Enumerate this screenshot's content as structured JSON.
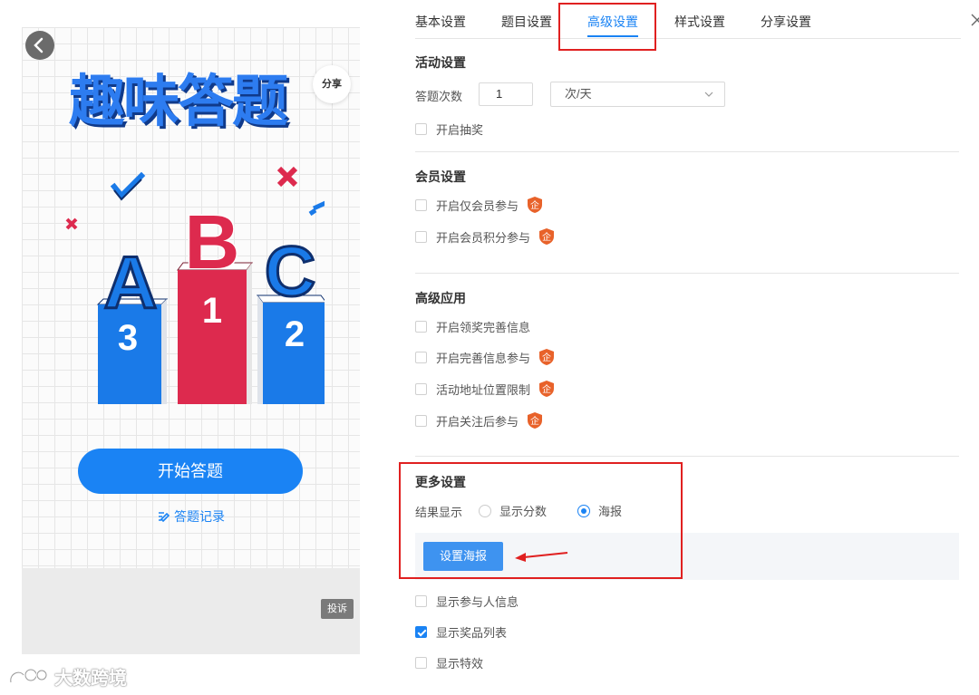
{
  "preview": {
    "back_icon": "chevron-left-icon",
    "share_label": "分享",
    "game_title": "趣味答题",
    "podium": {
      "letters": [
        "A",
        "B",
        "C"
      ],
      "ranks": [
        "3",
        "1",
        "2"
      ],
      "colors": {
        "blue": "#1a7ae8",
        "red": "#dd2a4e",
        "dark": "#0e2f6e"
      }
    },
    "start_button": "开始答题",
    "record_link": "答题记录",
    "complain_button": "投诉"
  },
  "watermark": "大数跨境",
  "settings": {
    "tabs": [
      {
        "label": "基本设置",
        "active": false
      },
      {
        "label": "题目设置",
        "active": false
      },
      {
        "label": "高级设置",
        "active": true
      },
      {
        "label": "样式设置",
        "active": false
      },
      {
        "label": "分享设置",
        "active": false
      }
    ],
    "activity": {
      "title": "活动设置",
      "attempts_label": "答题次数",
      "attempts_value": "1",
      "frequency_selected": "次/天",
      "lottery_label": "开启抽奖",
      "lottery_checked": false
    },
    "member": {
      "title": "会员设置",
      "items": [
        {
          "label": "开启仅会员参与",
          "checked": false,
          "enterprise_badge": "企"
        },
        {
          "label": "开启会员积分参与",
          "checked": false,
          "enterprise_badge": "企"
        }
      ]
    },
    "advanced": {
      "title": "高级应用",
      "items": [
        {
          "label": "开启领奖完善信息",
          "checked": false,
          "enterprise_badge": null
        },
        {
          "label": "开启完善信息参与",
          "checked": false,
          "enterprise_badge": "企"
        },
        {
          "label": "活动地址位置限制",
          "checked": false,
          "enterprise_badge": "企"
        },
        {
          "label": "开启关注后参与",
          "checked": false,
          "enterprise_badge": "企"
        }
      ]
    },
    "more": {
      "title": "更多设置",
      "result_label": "结果显示",
      "result_options": [
        {
          "label": "显示分数",
          "selected": false
        },
        {
          "label": "海报",
          "selected": true
        }
      ],
      "poster_button": "设置海报",
      "items": [
        {
          "label": "显示参与人信息",
          "checked": false
        },
        {
          "label": "显示奖品列表",
          "checked": true
        },
        {
          "label": "显示特效",
          "checked": false
        }
      ]
    }
  },
  "colors": {
    "accent": "#1a83f4",
    "highlight_box": "#e02020",
    "badge": "#e8622a"
  }
}
